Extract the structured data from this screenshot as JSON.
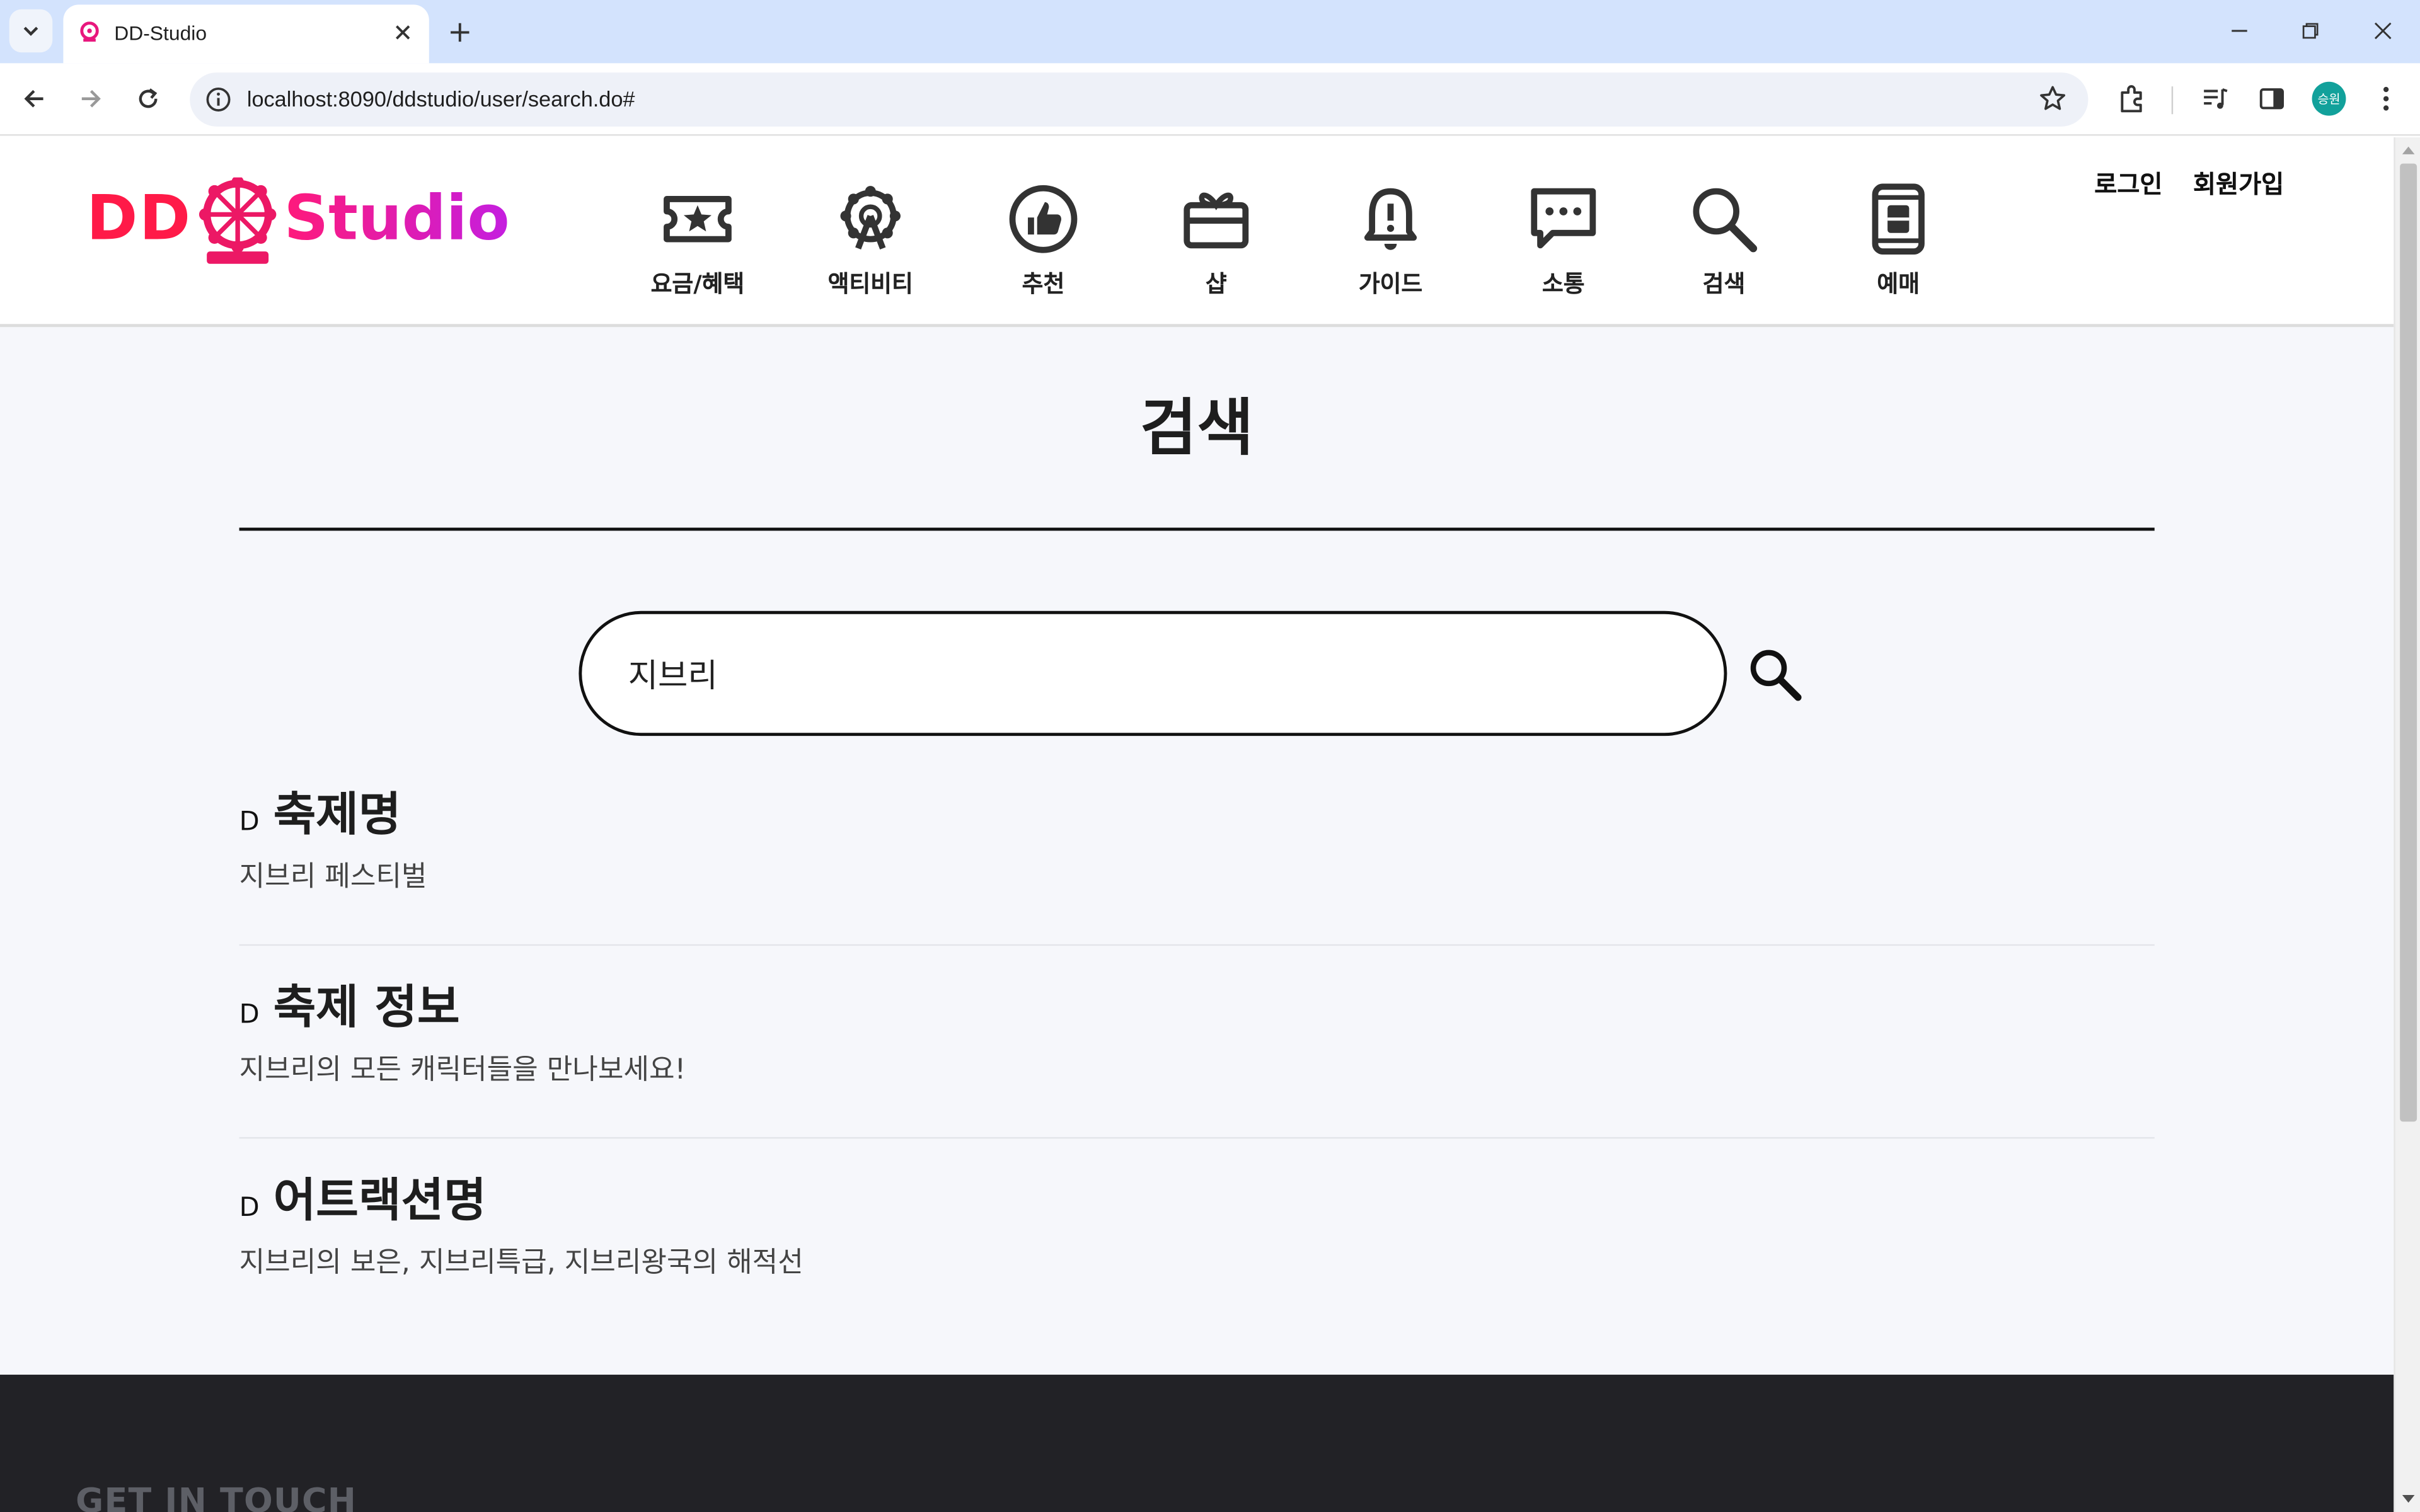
{
  "browser": {
    "tab_title": "DD-Studio",
    "url": "localhost:8090/ddstudio/user/search.do#",
    "avatar_text": "승원"
  },
  "site": {
    "logo_left": "DD",
    "logo_right": "Studio",
    "nav": [
      {
        "label": "요금/혜택",
        "icon": "ticket-star-icon"
      },
      {
        "label": "액티비티",
        "icon": "ferris-wheel-icon"
      },
      {
        "label": "추천",
        "icon": "thumbs-up-icon"
      },
      {
        "label": "샵",
        "icon": "gift-box-icon"
      },
      {
        "label": "가이드",
        "icon": "bell-alert-icon"
      },
      {
        "label": "소통",
        "icon": "chat-bubble-icon"
      },
      {
        "label": "검색",
        "icon": "search-icon"
      },
      {
        "label": "예매",
        "icon": "phone-ticket-icon"
      }
    ],
    "auth": {
      "login": "로그인",
      "signup": "회원가입"
    }
  },
  "main": {
    "title": "검색",
    "search": {
      "value": "지브리"
    },
    "results": [
      {
        "marker": "D",
        "title": "축제명",
        "desc": "지브리 페스티벌"
      },
      {
        "marker": "D",
        "title": "축제 정보",
        "desc": "지브리의 모든 캐릭터들을 만나보세요!"
      },
      {
        "marker": "D",
        "title": "어트랙션명",
        "desc": "지브리의 보은, 지브리특급, 지브리왕국의 해적선"
      }
    ]
  },
  "footer": {
    "title": "GET IN TOUCH"
  },
  "colors": {
    "brand_red": "#ff1a48",
    "brand_magenta": "#c41ee0",
    "footer_bg": "#222226"
  }
}
